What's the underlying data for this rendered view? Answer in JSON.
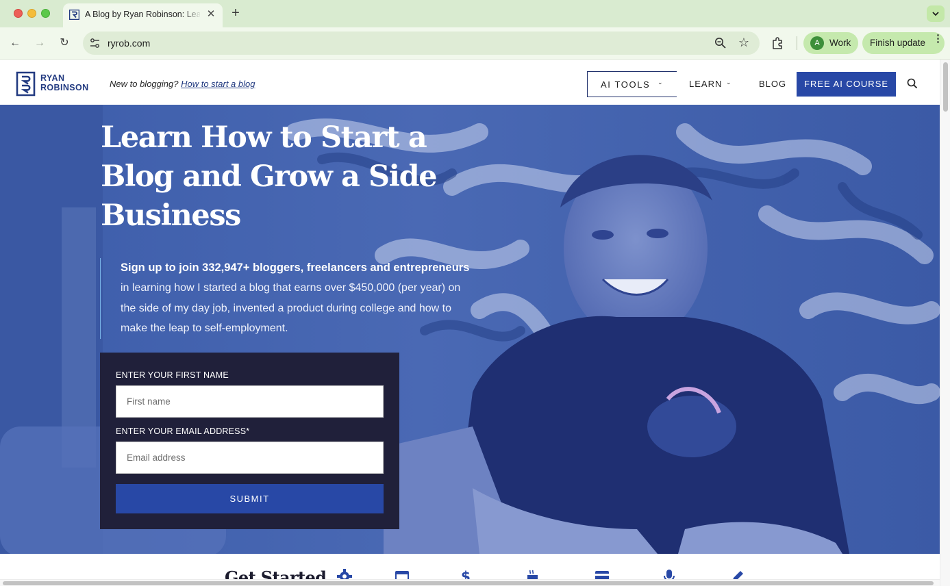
{
  "browser": {
    "tab_title": "A Blog by Ryan Robinson: Learn How to Start a Blog",
    "tab_close": "✕",
    "new_tab": "+",
    "url": "ryrob.com",
    "profile_initial": "A",
    "profile_label": "Work",
    "update_label": "Finish update",
    "kebab": "⋮",
    "back": "←",
    "forward": "→",
    "reload": "↻",
    "star": "☆"
  },
  "site": {
    "logo_line1": "RYAN",
    "logo_line2": "ROBINSON",
    "tagline_prefix": "New to blogging?",
    "tagline_link": "How to start a blog",
    "nav": {
      "ai_tools": "AI TOOLS",
      "learn": "LEARN",
      "blog": "BLOG",
      "cta": "FREE AI COURSE",
      "chevron": "⌄"
    }
  },
  "hero": {
    "title": "Learn How to Start a Blog and Grow a Side Business",
    "intro_bold": "Sign up to join 332,947+ bloggers, freelancers and entrepreneurs",
    "intro_body": "in learning how I started a blog that earns over $450,000 (per year) on the side of my day job, invented a product during college and how to make the leap to self-employment.",
    "form": {
      "first_name_label": "ENTER YOUR FIRST NAME",
      "first_name_placeholder": "First name",
      "email_label": "ENTER YOUR EMAIL ADDRESS*",
      "email_placeholder": "Email address",
      "submit": "SUBMIT"
    }
  },
  "strip": {
    "title": "Get Started"
  },
  "colors": {
    "brand_navy": "#233b81",
    "brand_blue": "#2848a6",
    "form_bg": "#20203a",
    "chrome_green": "#d9ebd0"
  }
}
